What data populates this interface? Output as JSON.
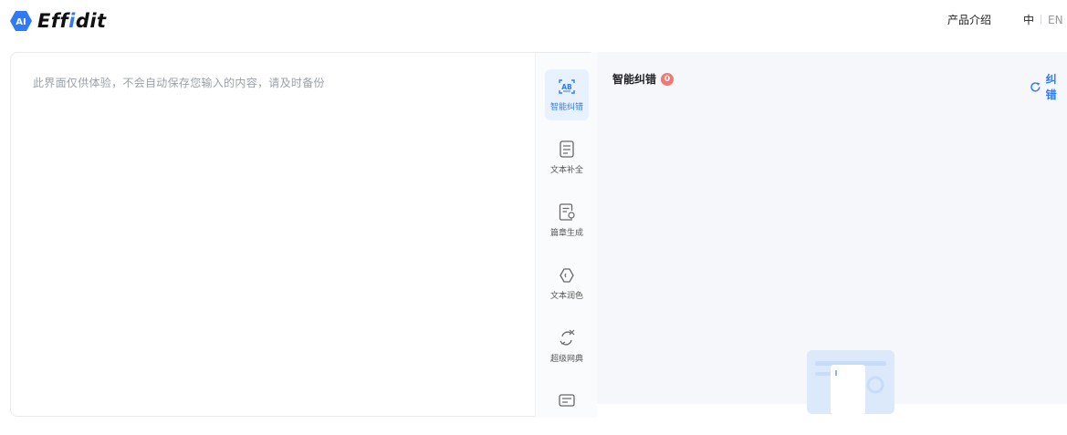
{
  "header": {
    "logo_badge": "AI",
    "logo_text_prefix": "Eff",
    "logo_text_i": "i",
    "logo_text_suffix": "dit",
    "nav_product": "产品介绍",
    "lang_zh": "中",
    "lang_en": "EN"
  },
  "editor": {
    "placeholder": "此界面仅供体验，不会自动保存您输入的内容，请及时备份"
  },
  "toolbar": {
    "items": [
      {
        "label": "智能纠错",
        "icon": "ab-correct-icon",
        "active": true
      },
      {
        "label": "文本补全",
        "icon": "text-complete-icon",
        "active": false
      },
      {
        "label": "篇章生成",
        "icon": "article-generate-icon",
        "active": false
      },
      {
        "label": "文本润色",
        "icon": "polish-icon",
        "active": false
      },
      {
        "label": "超级网典",
        "icon": "super-dictionary-icon",
        "active": false
      },
      {
        "label": "",
        "icon": "more-tool-icon",
        "active": false
      }
    ]
  },
  "result": {
    "title": "智能纠错",
    "count": "0",
    "recheck_label": "纠错"
  },
  "colors": {
    "accent": "#2f7bf5",
    "badge": "#f07875",
    "panel_bg": "#f5f7fb"
  }
}
